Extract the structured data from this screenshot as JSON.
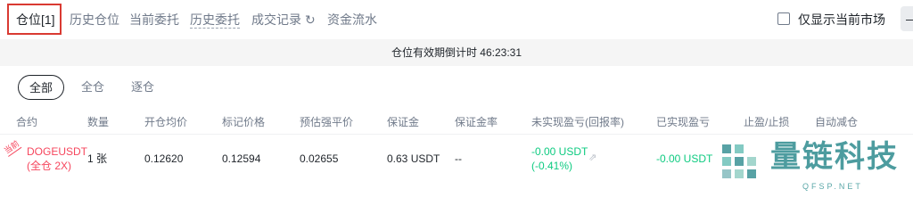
{
  "tabs": [
    {
      "label": "仓位[1]",
      "active": true
    },
    {
      "label": "历史仓位"
    },
    {
      "label": "当前委托"
    },
    {
      "label": "历史委托"
    },
    {
      "label": "成交记录"
    },
    {
      "label": "资金流水"
    }
  ],
  "filter_current_market": {
    "label": "仅显示当前市场",
    "checked": false
  },
  "collapse_label": "—",
  "countdown": "仓位有效期倒计时 46:23:31",
  "filters": [
    {
      "label": "全部",
      "active": true
    },
    {
      "label": "全仓"
    },
    {
      "label": "逐仓"
    }
  ],
  "table": {
    "columns": [
      "合约",
      "数量",
      "开仓均价",
      "标记价格",
      "预估强平价",
      "保证金",
      "保证金率",
      "未实现盈亏(回报率)",
      "已实现盈亏",
      "止盈/止损",
      "自动减仓"
    ],
    "rows": [
      {
        "tag": "当前",
        "symbol": "DOGEUSDT",
        "leverage": "(全仓 2X)",
        "quantity": "1 张",
        "entry_price": "0.12620",
        "mark_price": "0.12594",
        "liq_price": "0.02655",
        "margin": "0.63 USDT",
        "margin_ratio": "--",
        "unrealized_pnl": "-0.00 USDT",
        "roe": "(-0.41%)",
        "realized_pnl": "-0.00 USDT"
      }
    ]
  },
  "watermark": {
    "text": "量链科技",
    "domain": "QFSP.NET"
  },
  "colors": {
    "accent_red": "#d93a32",
    "loss_red": "#f6465d",
    "profit_green": "#0ecb81"
  }
}
